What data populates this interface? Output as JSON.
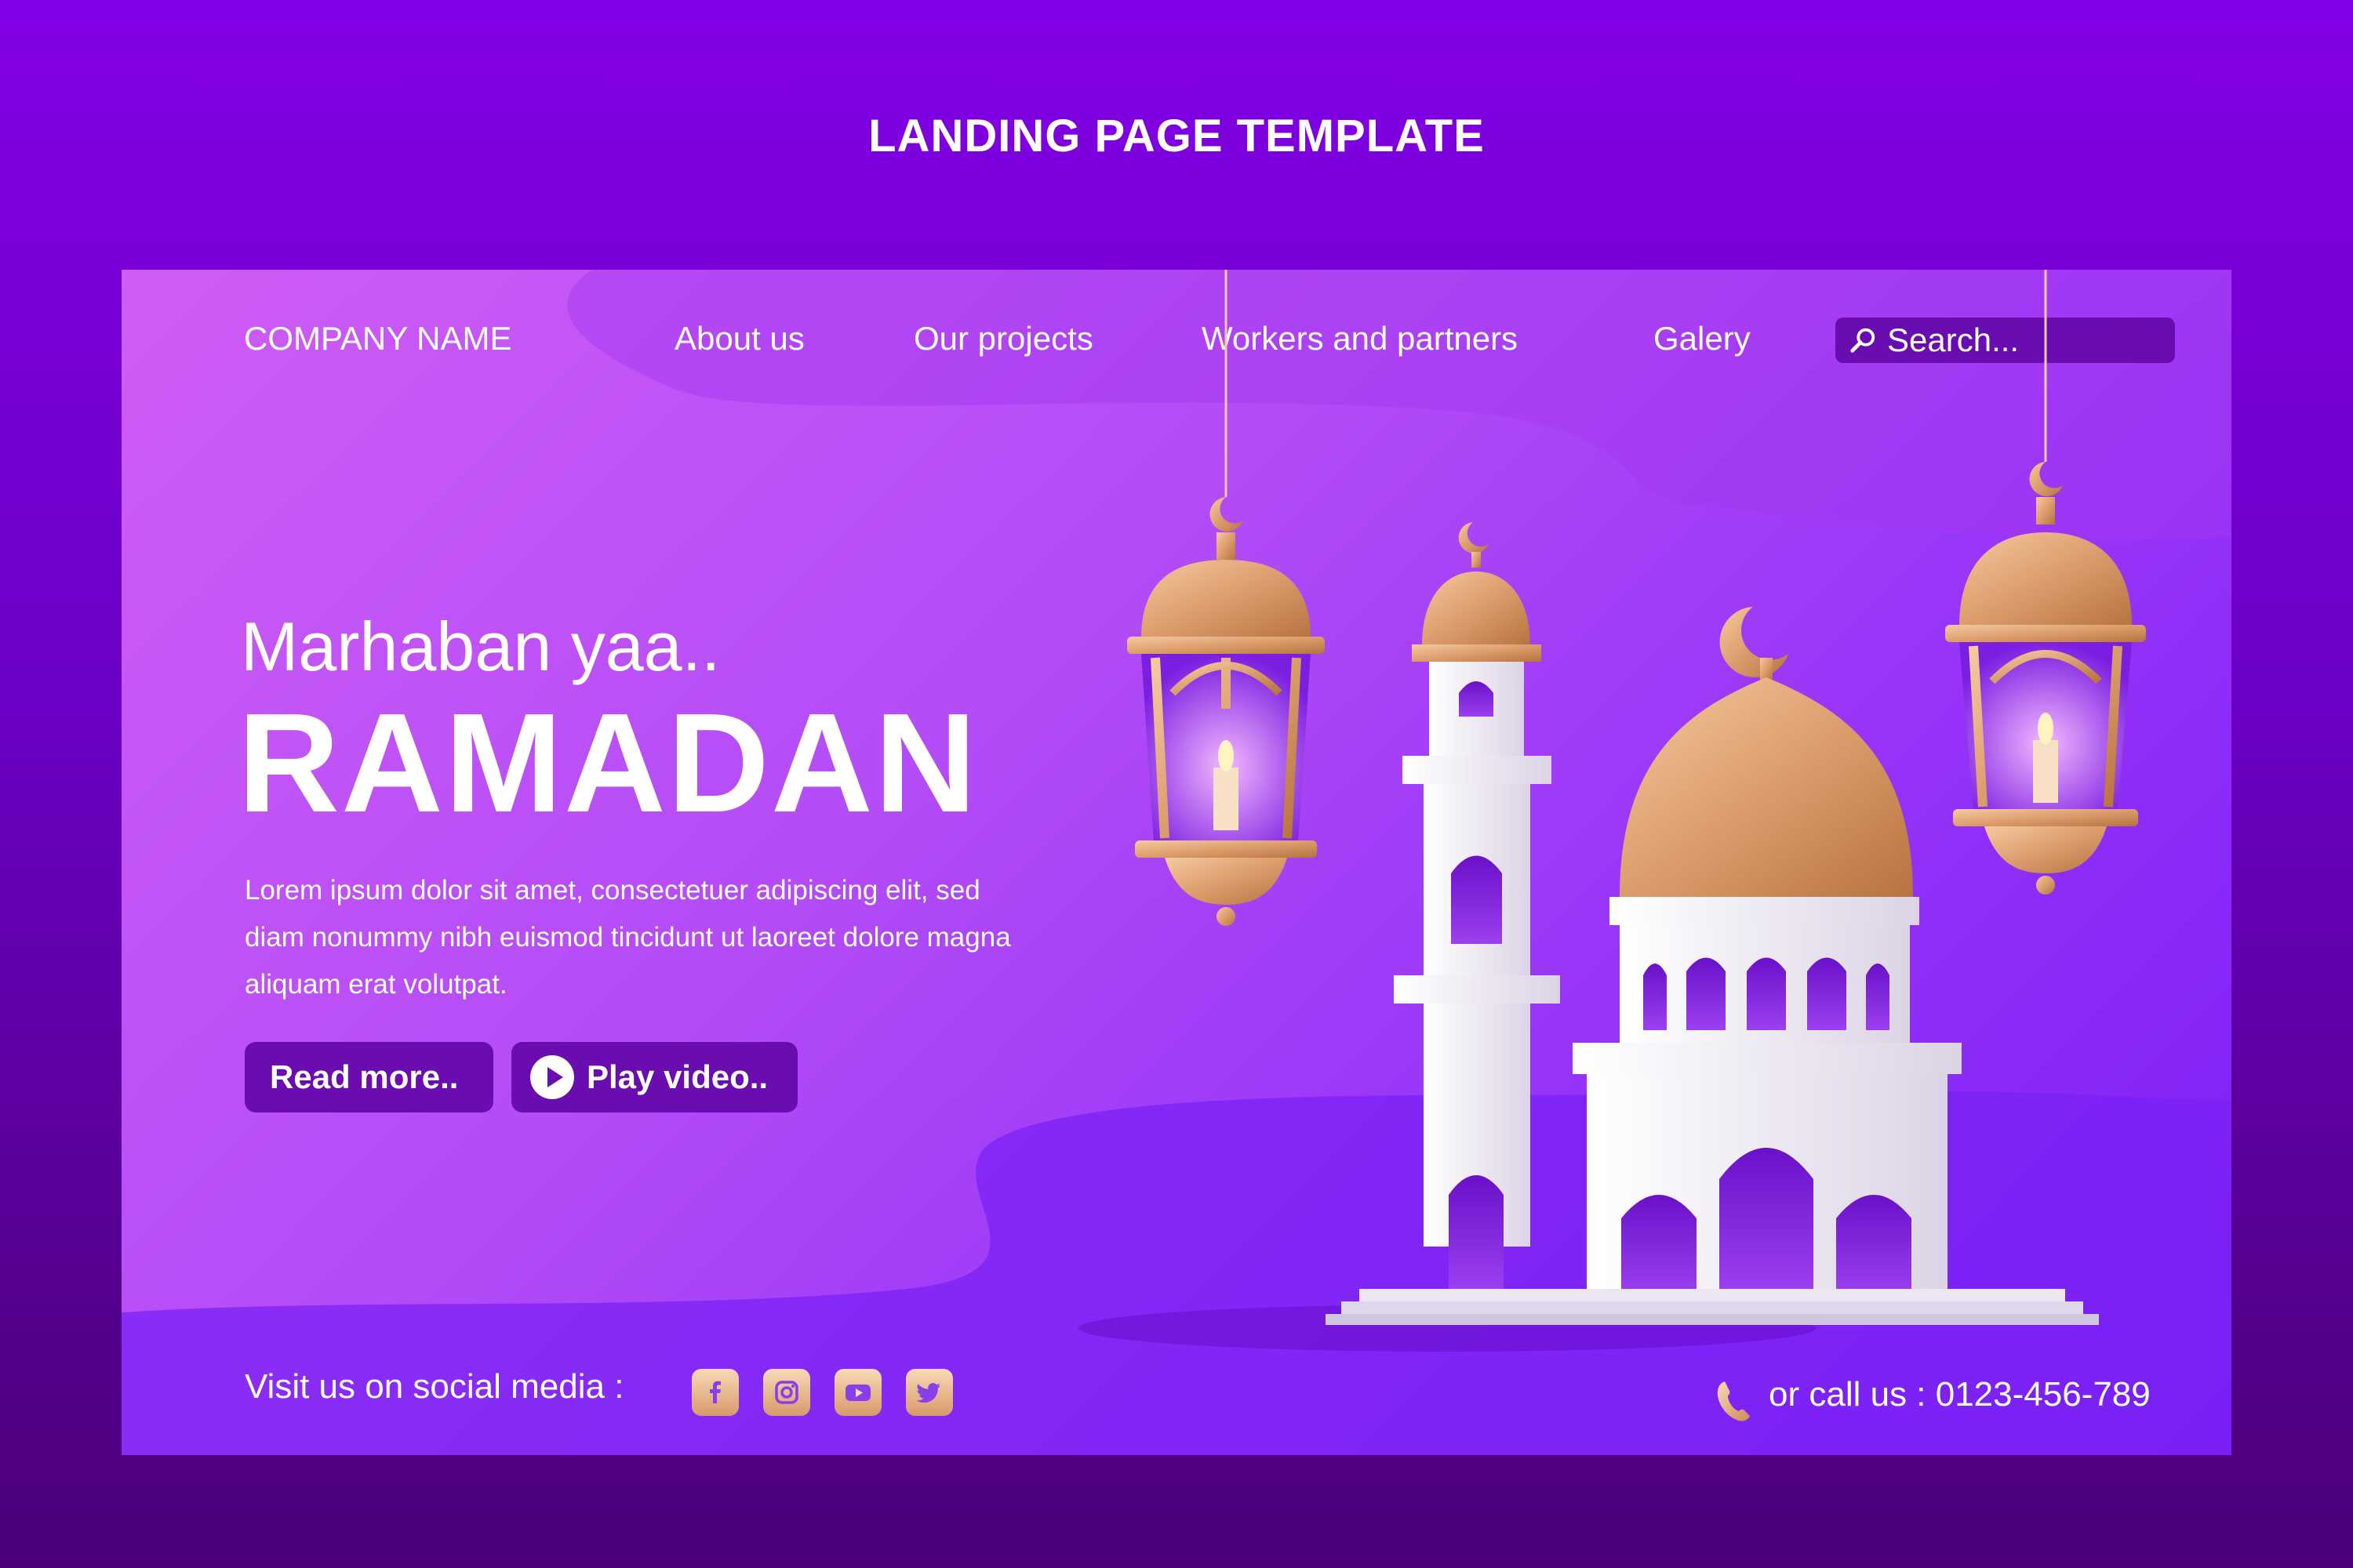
{
  "page_heading": "LANDING PAGE TEMPLATE",
  "nav": {
    "company": "COMPANY NAME",
    "items": [
      "About us",
      "Our projects",
      "Workers and partners",
      "Galery"
    ],
    "search_placeholder": "Search..."
  },
  "hero": {
    "greeting": "Marhaban yaa..",
    "title": "RAMADAN",
    "description": "Lorem ipsum dolor sit amet, consectetuer adipiscing elit, sed diam nonummy nibh euismod tincidunt ut laoreet dolore magna aliquam erat volutpat.",
    "read_more": "Read more..",
    "play_video": "Play video.."
  },
  "footer": {
    "social_label": "Visit us on social media :",
    "social_icons": [
      "facebook-icon",
      "instagram-icon",
      "youtube-icon",
      "twitter-icon"
    ],
    "call_label": "or call us : 0123-456-789"
  },
  "colors": {
    "background_top": "#8200e6",
    "background_bottom": "#4a0077",
    "card_start": "#cf5df6",
    "card_end": "#7a1ef6",
    "button": "#6a0db0",
    "gold": "#e0a070",
    "white": "#ffffff"
  }
}
